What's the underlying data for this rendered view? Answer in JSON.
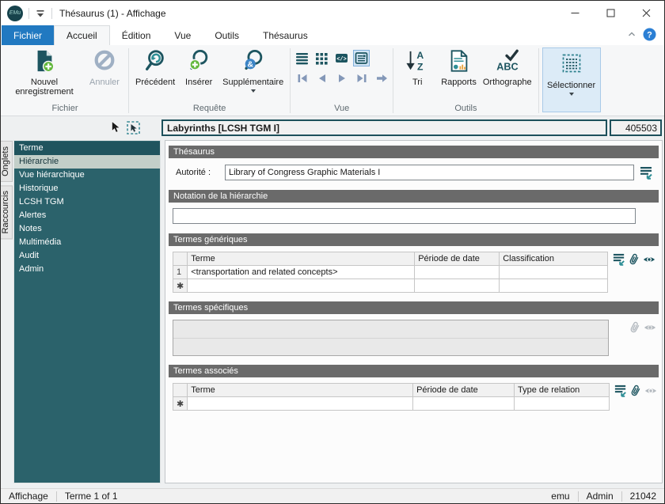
{
  "colors": {
    "accent_teal": "#1d5560",
    "sidebar_bg": "#2b626b",
    "sidebar_selected_bg": "#c3cfc9",
    "file_tab_blue": "#2179c1",
    "section_header_bg": "#6a6a6a",
    "green_plus": "#62b73c",
    "blue_ampersand": "#3d85c6",
    "disabled_slate": "#9fb0c4"
  },
  "titlebar": {
    "logo": "EMu",
    "title": "Thésaurus (1) - Affichage"
  },
  "tabs": {
    "items": [
      "Fichier",
      "Accueil",
      "Édition",
      "Vue",
      "Outils",
      "Thésaurus"
    ],
    "active": "Accueil"
  },
  "ribbon": {
    "fichier": {
      "label": "Fichier",
      "new_record": "Nouvel enregistrement",
      "cancel": "Annuler"
    },
    "requete": {
      "label": "Requête",
      "previous": "Précédent",
      "insert": "Insérer",
      "additional": "Supplémentaire"
    },
    "vue": {
      "label": "Vue"
    },
    "outils": {
      "label": "Outils",
      "sort": "Tri",
      "reports": "Rapports",
      "spelling": "Orthographe"
    },
    "select": {
      "label": "Sélectionner"
    }
  },
  "record_header": {
    "title": "Labyrinths [LCSH TGM I]",
    "irn": "405503"
  },
  "side_tabs": {
    "tabs_label": "Onglets",
    "shortcuts_label": "Raccourcis"
  },
  "sidebar": {
    "items": [
      "Terme",
      "Hiérarchie",
      "Vue hiérarchique",
      "Historique",
      "LCSH TGM",
      "Alertes",
      "Notes",
      "Multimédia",
      "Audit",
      "Admin"
    ],
    "selected": "Hiérarchie"
  },
  "sections": {
    "thesaurus": {
      "title": "Thésaurus",
      "authority_label": "Autorité :",
      "authority_value": "Library of Congress Graphic Materials I"
    },
    "notation": {
      "title": "Notation de la hiérarchie",
      "value": ""
    },
    "generic": {
      "title": "Termes génériques",
      "columns": [
        "Terme",
        "Période de date",
        "Classification"
      ],
      "rows": [
        {
          "num": "1",
          "terme": "<transportation and related concepts>",
          "periode": "",
          "classification": ""
        }
      ],
      "new_row_marker": "✱"
    },
    "specific": {
      "title": "Termes spécifiques"
    },
    "associated": {
      "title": "Termes associés",
      "columns": [
        "Terme",
        "Période de date",
        "Type de relation"
      ],
      "new_row_marker": "✱"
    }
  },
  "statusbar": {
    "view_mode": "Affichage",
    "record_position": "Terme 1 of 1",
    "user": "emu",
    "group": "Admin",
    "pid": "21042"
  }
}
